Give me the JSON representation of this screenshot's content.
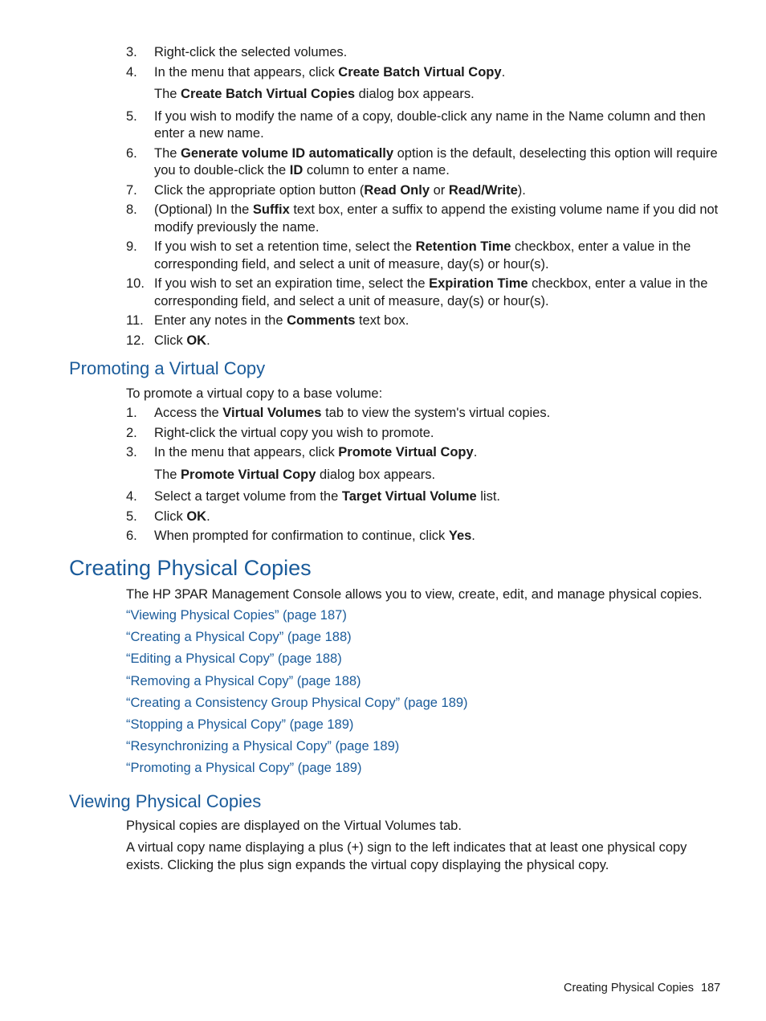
{
  "top_steps": [
    {
      "num": "3.",
      "parts": [
        {
          "t": "Right-click the selected volumes."
        }
      ]
    },
    {
      "num": "4.",
      "parts": [
        {
          "t": "In the menu that appears, click "
        },
        {
          "b": "Create Batch Virtual Copy"
        },
        {
          "t": "."
        }
      ],
      "note": [
        {
          "t": "The "
        },
        {
          "b": "Create Batch Virtual Copies"
        },
        {
          "t": " dialog box appears."
        }
      ]
    },
    {
      "num": "5.",
      "parts": [
        {
          "t": "If you wish to modify the name of a copy, double-click any name in the Name column and then enter a new name."
        }
      ]
    },
    {
      "num": "6.",
      "parts": [
        {
          "t": "The "
        },
        {
          "b": "Generate volume ID automatically"
        },
        {
          "t": " option is the default, deselecting this option will require you to double-click the "
        },
        {
          "b": "ID"
        },
        {
          "t": " column to enter a name."
        }
      ]
    },
    {
      "num": "7.",
      "parts": [
        {
          "t": "Click the appropriate option button ("
        },
        {
          "b": "Read Only"
        },
        {
          "t": " or "
        },
        {
          "b": "Read/Write"
        },
        {
          "t": ")."
        }
      ]
    },
    {
      "num": "8.",
      "parts": [
        {
          "t": "(Optional) In the "
        },
        {
          "b": "Suffix"
        },
        {
          "t": " text box, enter a suffix to append the existing volume name if you did not modify previously the name."
        }
      ]
    },
    {
      "num": "9.",
      "parts": [
        {
          "t": "If you wish to set a retention time, select the "
        },
        {
          "b": "Retention Time"
        },
        {
          "t": " checkbox, enter a value in the corresponding field, and select a unit of measure, day(s) or hour(s)."
        }
      ]
    },
    {
      "num": "10.",
      "parts": [
        {
          "t": "If you wish to set an expiration time, select the "
        },
        {
          "b": "Expiration Time"
        },
        {
          "t": " checkbox, enter a value in the corresponding field, and select a unit of measure, day(s) or hour(s)."
        }
      ]
    },
    {
      "num": "11.",
      "parts": [
        {
          "t": "Enter any notes in the "
        },
        {
          "b": "Comments"
        },
        {
          "t": " text box."
        }
      ]
    },
    {
      "num": "12.",
      "parts": [
        {
          "t": "Click "
        },
        {
          "b": "OK"
        },
        {
          "t": "."
        }
      ]
    }
  ],
  "promoting": {
    "heading": "Promoting a Virtual Copy",
    "intro": "To promote a virtual copy to a base volume:",
    "steps": [
      {
        "num": "1.",
        "parts": [
          {
            "t": "Access the "
          },
          {
            "b": "Virtual Volumes"
          },
          {
            "t": " tab to view the system's virtual copies."
          }
        ]
      },
      {
        "num": "2.",
        "parts": [
          {
            "t": "Right-click the virtual copy you wish to promote."
          }
        ]
      },
      {
        "num": "3.",
        "parts": [
          {
            "t": "In the menu that appears, click "
          },
          {
            "b": "Promote Virtual Copy"
          },
          {
            "t": "."
          }
        ],
        "note": [
          {
            "t": "The "
          },
          {
            "b": "Promote Virtual Copy"
          },
          {
            "t": " dialog box appears."
          }
        ]
      },
      {
        "num": "4.",
        "parts": [
          {
            "t": "Select a target volume from the "
          },
          {
            "b": "Target Virtual Volume"
          },
          {
            "t": " list."
          }
        ]
      },
      {
        "num": "5.",
        "parts": [
          {
            "t": "Click "
          },
          {
            "b": "OK"
          },
          {
            "t": "."
          }
        ]
      },
      {
        "num": "6.",
        "parts": [
          {
            "t": "When prompted for confirmation to continue, click "
          },
          {
            "b": "Yes"
          },
          {
            "t": "."
          }
        ]
      }
    ]
  },
  "creating": {
    "heading": "Creating Physical Copies",
    "intro": "The HP 3PAR Management Console allows you to view, create, edit, and manage physical copies.",
    "links": [
      "“Viewing Physical Copies” (page 187)",
      "“Creating a Physical Copy” (page 188)",
      "“Editing a Physical Copy” (page 188)",
      "“Removing a Physical Copy” (page 188)",
      "“Creating a Consistency Group Physical Copy” (page 189)",
      "“Stopping a Physical Copy” (page 189)",
      "“Resynchronizing a Physical Copy” (page 189)",
      "“Promoting a Physical Copy” (page 189)"
    ]
  },
  "viewing": {
    "heading": "Viewing Physical Copies",
    "para1": "Physical copies are displayed on the Virtual Volumes tab.",
    "para2": "A virtual copy name displaying a plus (+) sign to the left indicates that at least one physical copy exists. Clicking the plus sign expands the virtual copy displaying the physical copy."
  },
  "footer": {
    "section": "Creating Physical Copies",
    "page": "187"
  },
  "colors": {
    "heading": "#1a5b9a",
    "link": "#1a5b9a",
    "text": "#1a1a1a"
  }
}
